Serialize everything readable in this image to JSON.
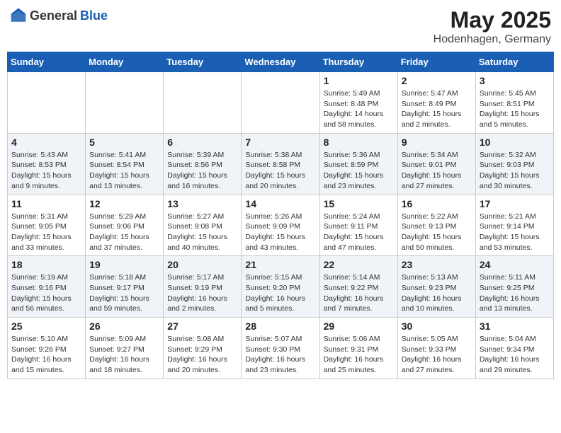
{
  "header": {
    "logo_general": "General",
    "logo_blue": "Blue",
    "month": "May 2025",
    "location": "Hodenhagen, Germany"
  },
  "weekdays": [
    "Sunday",
    "Monday",
    "Tuesday",
    "Wednesday",
    "Thursday",
    "Friday",
    "Saturday"
  ],
  "weeks": [
    [
      {
        "day": "",
        "info": ""
      },
      {
        "day": "",
        "info": ""
      },
      {
        "day": "",
        "info": ""
      },
      {
        "day": "",
        "info": ""
      },
      {
        "day": "1",
        "info": "Sunrise: 5:49 AM\nSunset: 8:48 PM\nDaylight: 14 hours\nand 58 minutes."
      },
      {
        "day": "2",
        "info": "Sunrise: 5:47 AM\nSunset: 8:49 PM\nDaylight: 15 hours\nand 2 minutes."
      },
      {
        "day": "3",
        "info": "Sunrise: 5:45 AM\nSunset: 8:51 PM\nDaylight: 15 hours\nand 5 minutes."
      }
    ],
    [
      {
        "day": "4",
        "info": "Sunrise: 5:43 AM\nSunset: 8:53 PM\nDaylight: 15 hours\nand 9 minutes."
      },
      {
        "day": "5",
        "info": "Sunrise: 5:41 AM\nSunset: 8:54 PM\nDaylight: 15 hours\nand 13 minutes."
      },
      {
        "day": "6",
        "info": "Sunrise: 5:39 AM\nSunset: 8:56 PM\nDaylight: 15 hours\nand 16 minutes."
      },
      {
        "day": "7",
        "info": "Sunrise: 5:38 AM\nSunset: 8:58 PM\nDaylight: 15 hours\nand 20 minutes."
      },
      {
        "day": "8",
        "info": "Sunrise: 5:36 AM\nSunset: 8:59 PM\nDaylight: 15 hours\nand 23 minutes."
      },
      {
        "day": "9",
        "info": "Sunrise: 5:34 AM\nSunset: 9:01 PM\nDaylight: 15 hours\nand 27 minutes."
      },
      {
        "day": "10",
        "info": "Sunrise: 5:32 AM\nSunset: 9:03 PM\nDaylight: 15 hours\nand 30 minutes."
      }
    ],
    [
      {
        "day": "11",
        "info": "Sunrise: 5:31 AM\nSunset: 9:05 PM\nDaylight: 15 hours\nand 33 minutes."
      },
      {
        "day": "12",
        "info": "Sunrise: 5:29 AM\nSunset: 9:06 PM\nDaylight: 15 hours\nand 37 minutes."
      },
      {
        "day": "13",
        "info": "Sunrise: 5:27 AM\nSunset: 9:08 PM\nDaylight: 15 hours\nand 40 minutes."
      },
      {
        "day": "14",
        "info": "Sunrise: 5:26 AM\nSunset: 9:09 PM\nDaylight: 15 hours\nand 43 minutes."
      },
      {
        "day": "15",
        "info": "Sunrise: 5:24 AM\nSunset: 9:11 PM\nDaylight: 15 hours\nand 47 minutes."
      },
      {
        "day": "16",
        "info": "Sunrise: 5:22 AM\nSunset: 9:13 PM\nDaylight: 15 hours\nand 50 minutes."
      },
      {
        "day": "17",
        "info": "Sunrise: 5:21 AM\nSunset: 9:14 PM\nDaylight: 15 hours\nand 53 minutes."
      }
    ],
    [
      {
        "day": "18",
        "info": "Sunrise: 5:19 AM\nSunset: 9:16 PM\nDaylight: 15 hours\nand 56 minutes."
      },
      {
        "day": "19",
        "info": "Sunrise: 5:18 AM\nSunset: 9:17 PM\nDaylight: 15 hours\nand 59 minutes."
      },
      {
        "day": "20",
        "info": "Sunrise: 5:17 AM\nSunset: 9:19 PM\nDaylight: 16 hours\nand 2 minutes."
      },
      {
        "day": "21",
        "info": "Sunrise: 5:15 AM\nSunset: 9:20 PM\nDaylight: 16 hours\nand 5 minutes."
      },
      {
        "day": "22",
        "info": "Sunrise: 5:14 AM\nSunset: 9:22 PM\nDaylight: 16 hours\nand 7 minutes."
      },
      {
        "day": "23",
        "info": "Sunrise: 5:13 AM\nSunset: 9:23 PM\nDaylight: 16 hours\nand 10 minutes."
      },
      {
        "day": "24",
        "info": "Sunrise: 5:11 AM\nSunset: 9:25 PM\nDaylight: 16 hours\nand 13 minutes."
      }
    ],
    [
      {
        "day": "25",
        "info": "Sunrise: 5:10 AM\nSunset: 9:26 PM\nDaylight: 16 hours\nand 15 minutes."
      },
      {
        "day": "26",
        "info": "Sunrise: 5:09 AM\nSunset: 9:27 PM\nDaylight: 16 hours\nand 18 minutes."
      },
      {
        "day": "27",
        "info": "Sunrise: 5:08 AM\nSunset: 9:29 PM\nDaylight: 16 hours\nand 20 minutes."
      },
      {
        "day": "28",
        "info": "Sunrise: 5:07 AM\nSunset: 9:30 PM\nDaylight: 16 hours\nand 23 minutes."
      },
      {
        "day": "29",
        "info": "Sunrise: 5:06 AM\nSunset: 9:31 PM\nDaylight: 16 hours\nand 25 minutes."
      },
      {
        "day": "30",
        "info": "Sunrise: 5:05 AM\nSunset: 9:33 PM\nDaylight: 16 hours\nand 27 minutes."
      },
      {
        "day": "31",
        "info": "Sunrise: 5:04 AM\nSunset: 9:34 PM\nDaylight: 16 hours\nand 29 minutes."
      }
    ]
  ]
}
